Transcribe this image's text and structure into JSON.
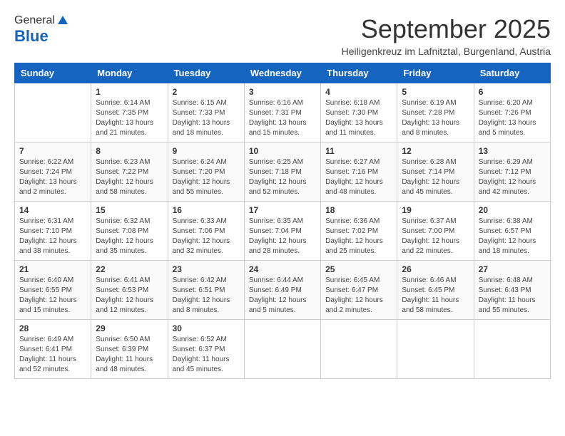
{
  "header": {
    "logo_general": "General",
    "logo_blue": "Blue",
    "month_title": "September 2025",
    "subtitle": "Heiligenkreuz im Lafnitztal, Burgenland, Austria"
  },
  "days_of_week": [
    "Sunday",
    "Monday",
    "Tuesday",
    "Wednesday",
    "Thursday",
    "Friday",
    "Saturday"
  ],
  "weeks": [
    [
      {
        "day": "",
        "info": ""
      },
      {
        "day": "1",
        "info": "Sunrise: 6:14 AM\nSunset: 7:35 PM\nDaylight: 13 hours\nand 21 minutes."
      },
      {
        "day": "2",
        "info": "Sunrise: 6:15 AM\nSunset: 7:33 PM\nDaylight: 13 hours\nand 18 minutes."
      },
      {
        "day": "3",
        "info": "Sunrise: 6:16 AM\nSunset: 7:31 PM\nDaylight: 13 hours\nand 15 minutes."
      },
      {
        "day": "4",
        "info": "Sunrise: 6:18 AM\nSunset: 7:30 PM\nDaylight: 13 hours\nand 11 minutes."
      },
      {
        "day": "5",
        "info": "Sunrise: 6:19 AM\nSunset: 7:28 PM\nDaylight: 13 hours\nand 8 minutes."
      },
      {
        "day": "6",
        "info": "Sunrise: 6:20 AM\nSunset: 7:26 PM\nDaylight: 13 hours\nand 5 minutes."
      }
    ],
    [
      {
        "day": "7",
        "info": "Sunrise: 6:22 AM\nSunset: 7:24 PM\nDaylight: 13 hours\nand 2 minutes."
      },
      {
        "day": "8",
        "info": "Sunrise: 6:23 AM\nSunset: 7:22 PM\nDaylight: 12 hours\nand 58 minutes."
      },
      {
        "day": "9",
        "info": "Sunrise: 6:24 AM\nSunset: 7:20 PM\nDaylight: 12 hours\nand 55 minutes."
      },
      {
        "day": "10",
        "info": "Sunrise: 6:25 AM\nSunset: 7:18 PM\nDaylight: 12 hours\nand 52 minutes."
      },
      {
        "day": "11",
        "info": "Sunrise: 6:27 AM\nSunset: 7:16 PM\nDaylight: 12 hours\nand 48 minutes."
      },
      {
        "day": "12",
        "info": "Sunrise: 6:28 AM\nSunset: 7:14 PM\nDaylight: 12 hours\nand 45 minutes."
      },
      {
        "day": "13",
        "info": "Sunrise: 6:29 AM\nSunset: 7:12 PM\nDaylight: 12 hours\nand 42 minutes."
      }
    ],
    [
      {
        "day": "14",
        "info": "Sunrise: 6:31 AM\nSunset: 7:10 PM\nDaylight: 12 hours\nand 38 minutes."
      },
      {
        "day": "15",
        "info": "Sunrise: 6:32 AM\nSunset: 7:08 PM\nDaylight: 12 hours\nand 35 minutes."
      },
      {
        "day": "16",
        "info": "Sunrise: 6:33 AM\nSunset: 7:06 PM\nDaylight: 12 hours\nand 32 minutes."
      },
      {
        "day": "17",
        "info": "Sunrise: 6:35 AM\nSunset: 7:04 PM\nDaylight: 12 hours\nand 28 minutes."
      },
      {
        "day": "18",
        "info": "Sunrise: 6:36 AM\nSunset: 7:02 PM\nDaylight: 12 hours\nand 25 minutes."
      },
      {
        "day": "19",
        "info": "Sunrise: 6:37 AM\nSunset: 7:00 PM\nDaylight: 12 hours\nand 22 minutes."
      },
      {
        "day": "20",
        "info": "Sunrise: 6:38 AM\nSunset: 6:57 PM\nDaylight: 12 hours\nand 18 minutes."
      }
    ],
    [
      {
        "day": "21",
        "info": "Sunrise: 6:40 AM\nSunset: 6:55 PM\nDaylight: 12 hours\nand 15 minutes."
      },
      {
        "day": "22",
        "info": "Sunrise: 6:41 AM\nSunset: 6:53 PM\nDaylight: 12 hours\nand 12 minutes."
      },
      {
        "day": "23",
        "info": "Sunrise: 6:42 AM\nSunset: 6:51 PM\nDaylight: 12 hours\nand 8 minutes."
      },
      {
        "day": "24",
        "info": "Sunrise: 6:44 AM\nSunset: 6:49 PM\nDaylight: 12 hours\nand 5 minutes."
      },
      {
        "day": "25",
        "info": "Sunrise: 6:45 AM\nSunset: 6:47 PM\nDaylight: 12 hours\nand 2 minutes."
      },
      {
        "day": "26",
        "info": "Sunrise: 6:46 AM\nSunset: 6:45 PM\nDaylight: 11 hours\nand 58 minutes."
      },
      {
        "day": "27",
        "info": "Sunrise: 6:48 AM\nSunset: 6:43 PM\nDaylight: 11 hours\nand 55 minutes."
      }
    ],
    [
      {
        "day": "28",
        "info": "Sunrise: 6:49 AM\nSunset: 6:41 PM\nDaylight: 11 hours\nand 52 minutes."
      },
      {
        "day": "29",
        "info": "Sunrise: 6:50 AM\nSunset: 6:39 PM\nDaylight: 11 hours\nand 48 minutes."
      },
      {
        "day": "30",
        "info": "Sunrise: 6:52 AM\nSunset: 6:37 PM\nDaylight: 11 hours\nand 45 minutes."
      },
      {
        "day": "",
        "info": ""
      },
      {
        "day": "",
        "info": ""
      },
      {
        "day": "",
        "info": ""
      },
      {
        "day": "",
        "info": ""
      }
    ]
  ]
}
